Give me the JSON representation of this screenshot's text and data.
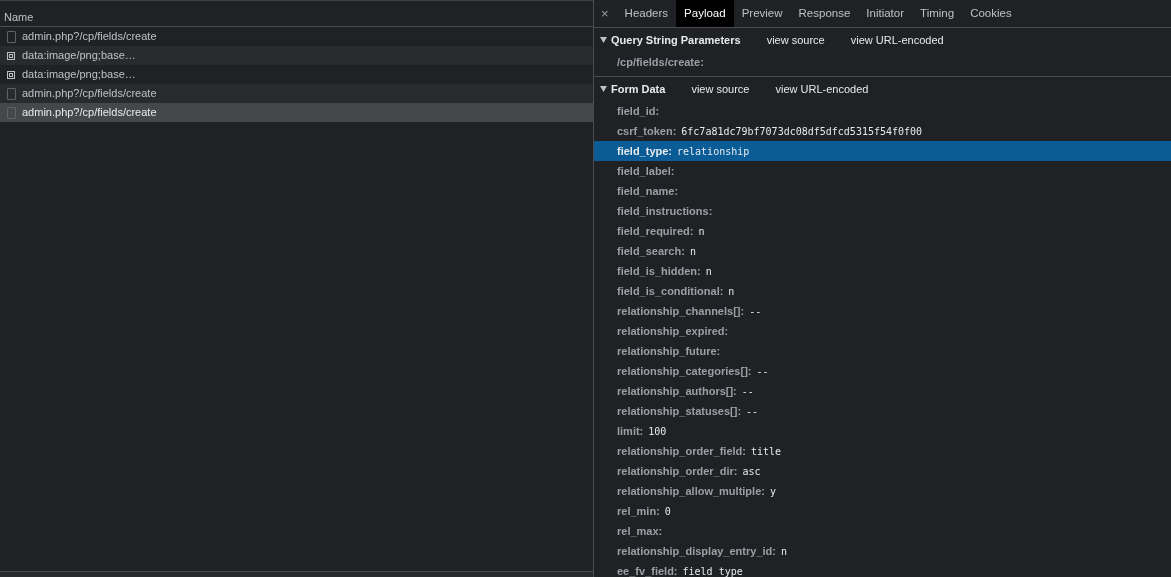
{
  "requests": {
    "column": "Name",
    "rows": [
      {
        "name": "admin.php?/cp/fields/create",
        "kind": "document",
        "selected": false
      },
      {
        "name": "data:image/png;base…",
        "kind": "image",
        "selected": false
      },
      {
        "name": "data:image/png;base…",
        "kind": "image",
        "selected": false
      },
      {
        "name": "admin.php?/cp/fields/create",
        "kind": "document",
        "selected": false
      },
      {
        "name": "admin.php?/cp/fields/create",
        "kind": "document",
        "selected": true
      }
    ]
  },
  "close": "×",
  "tabs": [
    {
      "label": "Headers",
      "selected": false
    },
    {
      "label": "Payload",
      "selected": true
    },
    {
      "label": "Preview",
      "selected": false
    },
    {
      "label": "Response",
      "selected": false
    },
    {
      "label": "Initiator",
      "selected": false
    },
    {
      "label": "Timing",
      "selected": false
    },
    {
      "label": "Cookies",
      "selected": false
    }
  ],
  "sections": [
    {
      "title": "Query String Parameters",
      "expanded": true,
      "links": [
        "view source",
        "view URL-encoded"
      ],
      "params": [
        {
          "key": "/cp/fields/create:",
          "selected": false
        }
      ]
    },
    {
      "title": "Form Data",
      "expanded": true,
      "links": [
        "view source",
        "view URL-encoded"
      ],
      "params": [
        {
          "key": "field_id:",
          "selected": false
        },
        {
          "key": "csrf_token:",
          "value": "6fc7a81dc79bf7073dc08df5dfcd5315f54f0f00",
          "selected": false
        },
        {
          "key": "field_type:",
          "value": "relationship",
          "selected": true
        },
        {
          "key": "field_label:",
          "selected": false
        },
        {
          "key": "field_name:",
          "selected": false
        },
        {
          "key": "field_instructions:",
          "selected": false
        },
        {
          "key": "field_required:",
          "value": "n",
          "selected": false
        },
        {
          "key": "field_search:",
          "value": "n",
          "selected": false
        },
        {
          "key": "field_is_hidden:",
          "value": "n",
          "selected": false
        },
        {
          "key": "field_is_conditional:",
          "value": "n",
          "selected": false
        },
        {
          "key": "relationship_channels[]:",
          "value": "--",
          "selected": false
        },
        {
          "key": "relationship_expired:",
          "selected": false
        },
        {
          "key": "relationship_future:",
          "selected": false
        },
        {
          "key": "relationship_categories[]:",
          "value": "--",
          "selected": false
        },
        {
          "key": "relationship_authors[]:",
          "value": "--",
          "selected": false
        },
        {
          "key": "relationship_statuses[]:",
          "value": "--",
          "selected": false
        },
        {
          "key": "limit:",
          "value": "100",
          "selected": false
        },
        {
          "key": "relationship_order_field:",
          "value": "title",
          "selected": false
        },
        {
          "key": "relationship_order_dir:",
          "value": "asc",
          "selected": false
        },
        {
          "key": "relationship_allow_multiple:",
          "value": "y",
          "selected": false
        },
        {
          "key": "rel_min:",
          "value": "0",
          "selected": false
        },
        {
          "key": "rel_max:",
          "selected": false
        },
        {
          "key": "relationship_display_entry_id:",
          "value": "n",
          "selected": false
        },
        {
          "key": "ee_fv_field:",
          "value": "field_type",
          "selected": false
        }
      ]
    }
  ]
}
